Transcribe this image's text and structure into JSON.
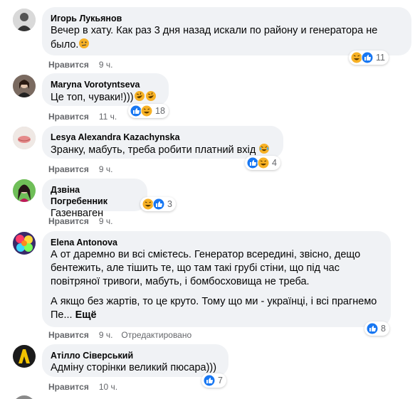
{
  "comments": [
    {
      "author": "Игорь Лукьянов",
      "text": "Вечер в хату. Как раз 3 дня назад искали по району и генератора не было.",
      "inline_emoji": "thinking-face",
      "reactions": [
        "haha",
        "like"
      ],
      "reaction_count": "11",
      "like_label": "Нравится",
      "time": "9 ч."
    },
    {
      "author": "Maryna Vorotyntseva",
      "text": "Це топ, чуваки!)))",
      "inline_emoji": "rofl x2",
      "reactions": [
        "like",
        "haha"
      ],
      "reaction_count": "18",
      "like_label": "Нравится",
      "time": "11 ч."
    },
    {
      "author": "Lesya Alexandra Kazachynska",
      "text": "Зранку, мабуть, треба робити платний вхід",
      "inline_emoji": "laughing-tears",
      "reactions": [
        "like",
        "haha"
      ],
      "reaction_count": "4",
      "like_label": "Нравится",
      "time": "9 ч."
    },
    {
      "author": "Дзвіна Погребенник",
      "text": "Газенваген",
      "reactions": [
        "haha",
        "like"
      ],
      "reaction_count": "3",
      "like_label": "Нравится",
      "time": "9 ч."
    },
    {
      "author": "Elena Antonova",
      "paragraph1": "А от даремно ви всі смієтесь. Генератор всередині, звісно, дещо бентежить, але тішить те, що там такі грубі стіни, що під час повітряної тривоги, мабуть, і бомбосховища не треба.",
      "paragraph2": "А якщо без жартів, то це круто. Тому що ми - українці, і всі прагнемо Пе...",
      "more": "Ещё",
      "reactions": [
        "like"
      ],
      "reaction_count": "8",
      "like_label": "Нравится",
      "time": "9 ч.",
      "edited": "Отредактировано"
    },
    {
      "author": "Атілло Сіверський",
      "text": "Адміну сторінки великий пюсара)))",
      "reactions": [
        "like"
      ],
      "reaction_count": "7",
      "like_label": "Нравится",
      "time": "10 ч."
    }
  ],
  "colors": {
    "bubble": "#f0f2f5",
    "like_blue": "#1877f2",
    "haha_yellow": "#f7b125",
    "meta_gray": "#65676b"
  }
}
